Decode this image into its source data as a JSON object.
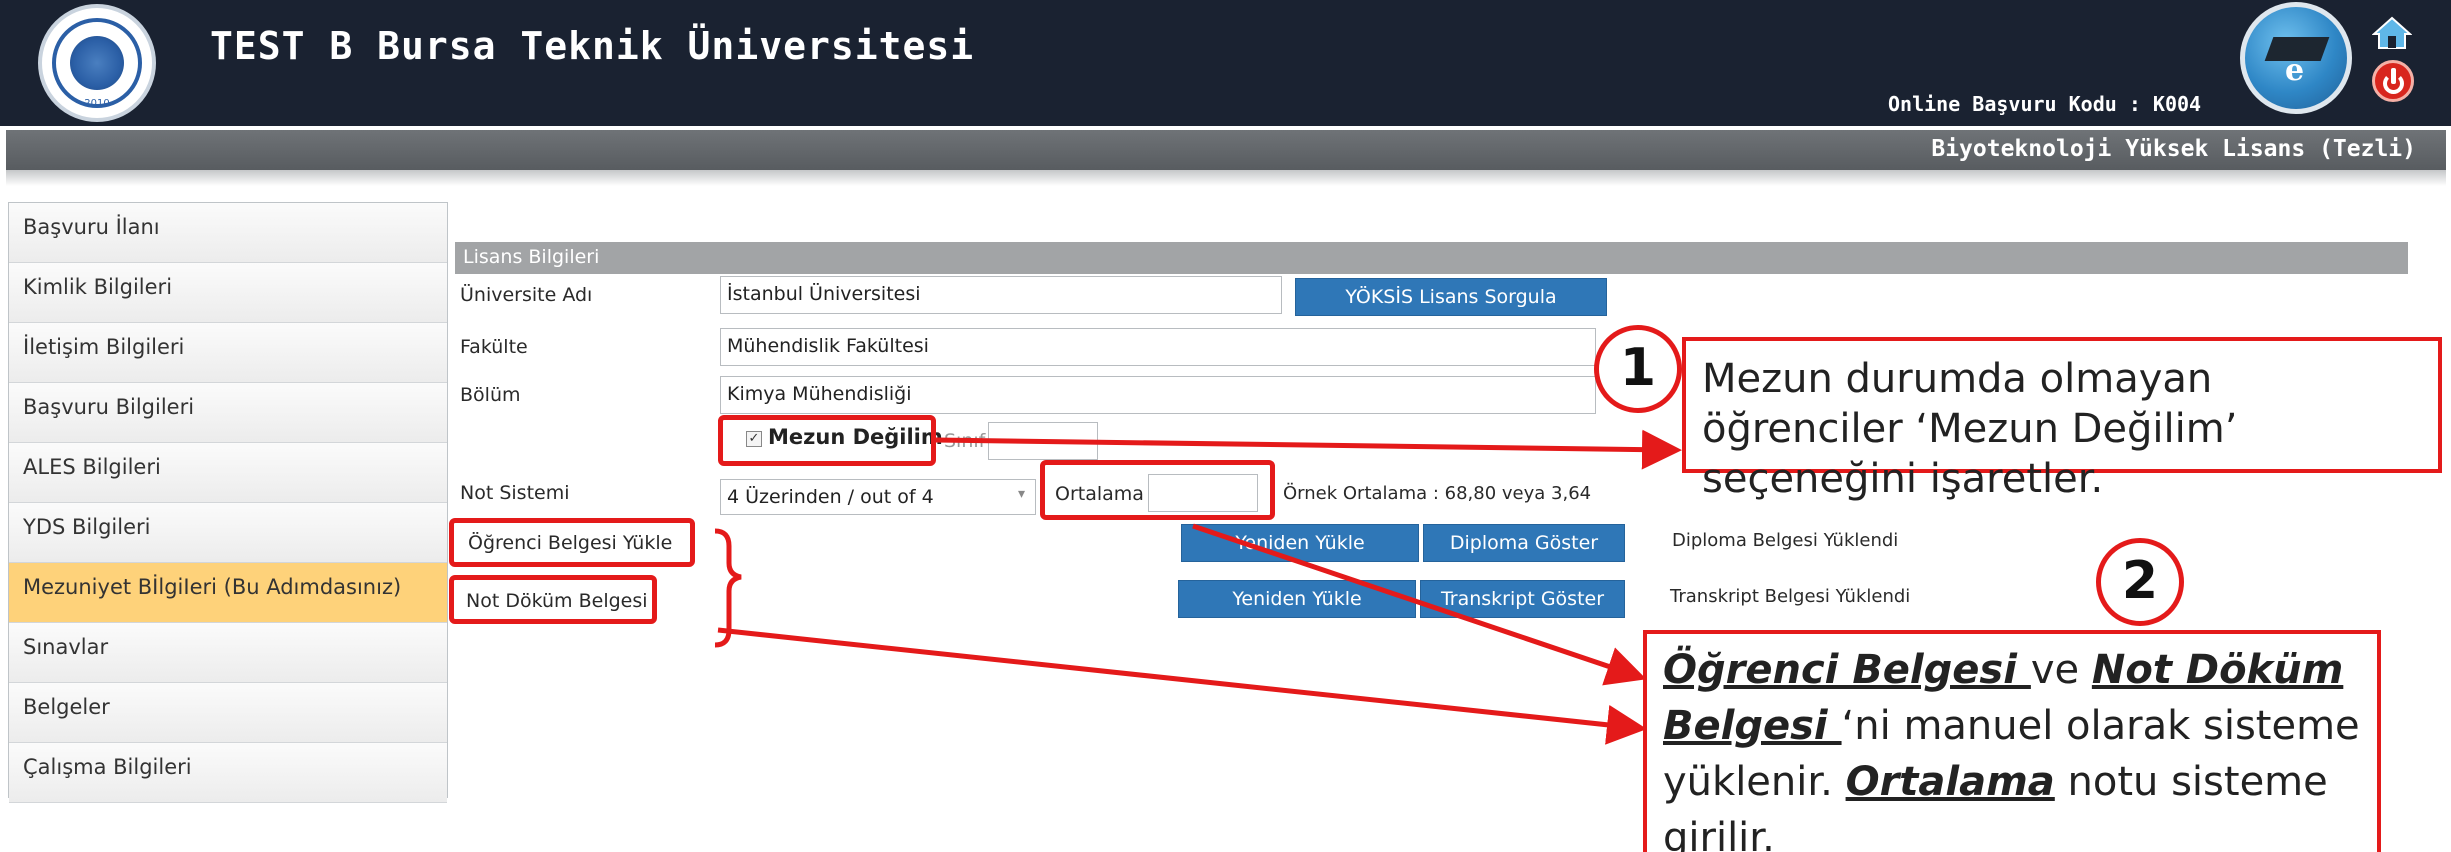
{
  "header": {
    "logo_year": "2010",
    "site_title": "TEST B Bursa Teknik Üniversitesi",
    "online_code": "Online Başvuru Kodu : K004",
    "program_name": "Biyoteknoloji Yüksek Lisans (Tezli)",
    "icons": {
      "logo": "university-seal-icon",
      "badge": "e-education-badge-icon",
      "home": "home-icon",
      "power": "power-icon"
    }
  },
  "sidebar": {
    "items": [
      {
        "label": "Başvuru İlanı",
        "active": false
      },
      {
        "label": "Kimlik Bilgileri",
        "active": false
      },
      {
        "label": "İletişim Bilgileri",
        "active": false
      },
      {
        "label": "Başvuru Bilgileri",
        "active": false
      },
      {
        "label": "ALES Bilgileri",
        "active": false
      },
      {
        "label": "YDS Bilgileri",
        "active": false
      },
      {
        "label": "Mezuniyet BİlgiIeri (Bu Adımdasınız)",
        "active": true
      },
      {
        "label": "Sınavlar",
        "active": false
      },
      {
        "label": "Belgeler",
        "active": false
      },
      {
        "label": "Çalışma Bilgileri",
        "active": false
      }
    ]
  },
  "form": {
    "section_title": "Lisans Bilgileri",
    "university": {
      "label": "Üniversite Adı",
      "value": "İstanbul Üniversitesi",
      "button": "YÖKSİS Lisans Sorgula"
    },
    "faculty": {
      "label": "Fakülte",
      "value": "Mühendislik Fakültesi"
    },
    "department": {
      "label": "Bölüm",
      "value": "Kimya Mühendisliği"
    },
    "not_graduated": {
      "label": "Mezun Değilim",
      "checked": true,
      "class_label": "Sınıf",
      "class_value": ""
    },
    "grade_system": {
      "label": "Not Sistemi",
      "selected": "4 Üzerinden / out of 4",
      "average_label": "Ortalama",
      "average_value": "",
      "example": "Örnek Ortalama : 68,80 veya 3,64"
    },
    "student_doc": {
      "label": "Öğrenci Belgesi Yükle",
      "reupload": "Yeniden Yükle",
      "show": "Diploma Göster",
      "status": "Diploma Belgesi Yüklendi"
    },
    "transcript": {
      "label": "Not Döküm Belgesi",
      "reupload": "Yeniden Yükle",
      "show": "Transkript Göster",
      "status": "Transkript Belgesi Yüklendi"
    }
  },
  "annotations": {
    "callout1_number": "1",
    "callout1_text": "Mezun durumda olmayan öğrenciler ‘Mezun Değilim’ seçeneğini işaretler.",
    "callout2_number": "2",
    "callout2_part1": "Öğrenci Belgesi ",
    "callout2_part2": "ve ",
    "callout2_part3": "Not Döküm Belgesi ",
    "callout2_part4": "‘ni manuel olarak sisteme yüklenir. ",
    "callout2_part5": "Ortalama",
    "callout2_part6": " notu sisteme girilir.",
    "highlight_color": "#e41a1a"
  },
  "colors": {
    "header_bg": "#1a2231",
    "program_bar": "#5e6266",
    "active_menu": "#fed27a",
    "button": "#2f77b7",
    "section_header": "#a2a4a6"
  }
}
